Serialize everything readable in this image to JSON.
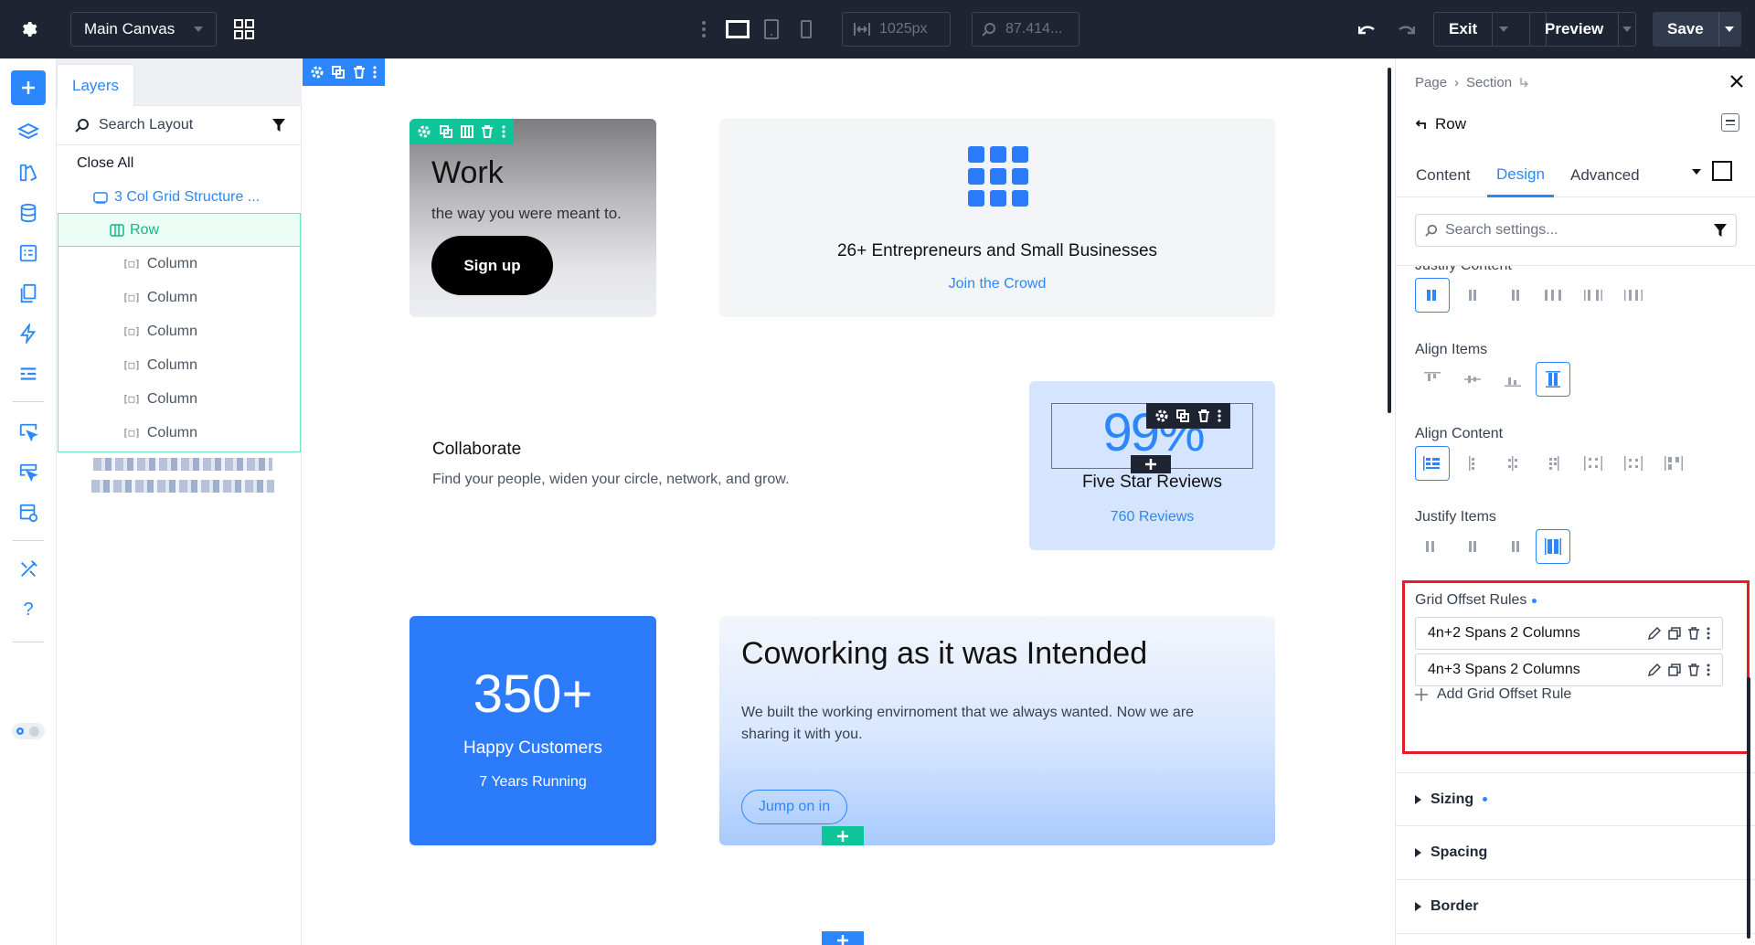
{
  "topbar": {
    "canvas_select": "Main Canvas",
    "width_value": "1025px",
    "zoom_value": "87.414...",
    "exit_label": "Exit",
    "preview_label": "Preview",
    "save_label": "Save"
  },
  "layers": {
    "tab_label": "Layers",
    "search_placeholder": "Search Layout",
    "close_all": "Close All",
    "section_item": "3 Col Grid Structure ...",
    "row_item": "Row",
    "columns": [
      "Column",
      "Column",
      "Column",
      "Column",
      "Column",
      "Column"
    ]
  },
  "canvas": {
    "work_heading": "Work",
    "work_sub": "the way you were meant to.",
    "signup_label": "Sign up",
    "entre_title": "26+ Entrepreneurs and Small Businesses",
    "entre_link": "Join the Crowd",
    "collab_title": "Collaborate",
    "collab_text": "Find your people, widen your circle, network, and grow.",
    "percent": "99%",
    "reviews_title": "Five Star Reviews",
    "reviews_link": "760 Reviews",
    "stat_number": "350+",
    "stat_label": "Happy Customers",
    "stat_sub": "7 Years Running",
    "cowork_title": "Coworking as it was Intended",
    "cowork_text": "We built the working envirnoment that we always wanted. Now we are sharing it with you.",
    "jump_label": "Jump on in"
  },
  "settings": {
    "breadcrumb": [
      "Page",
      "Section"
    ],
    "element_title": "Row",
    "tabs": [
      "Content",
      "Design",
      "Advanced"
    ],
    "active_tab": "Design",
    "search_placeholder": "Search settings...",
    "justify_content_label": "Justify Content",
    "align_items_label": "Align Items",
    "align_content_label": "Align Content",
    "justify_items_label": "Justify Items",
    "grid_offset": {
      "title": "Grid Offset Rules",
      "rules": [
        "4n+2 Spans 2 Columns",
        "4n+3 Spans 2 Columns"
      ],
      "add_label": "Add Grid Offset Rule"
    },
    "accordions": [
      "Sizing",
      "Spacing",
      "Border"
    ]
  },
  "colors": {
    "accent_blue": "#2b87fb",
    "accent_green": "#10c49a",
    "topbar_bg": "#1e2432",
    "highlight_red": "#e11d2a"
  }
}
